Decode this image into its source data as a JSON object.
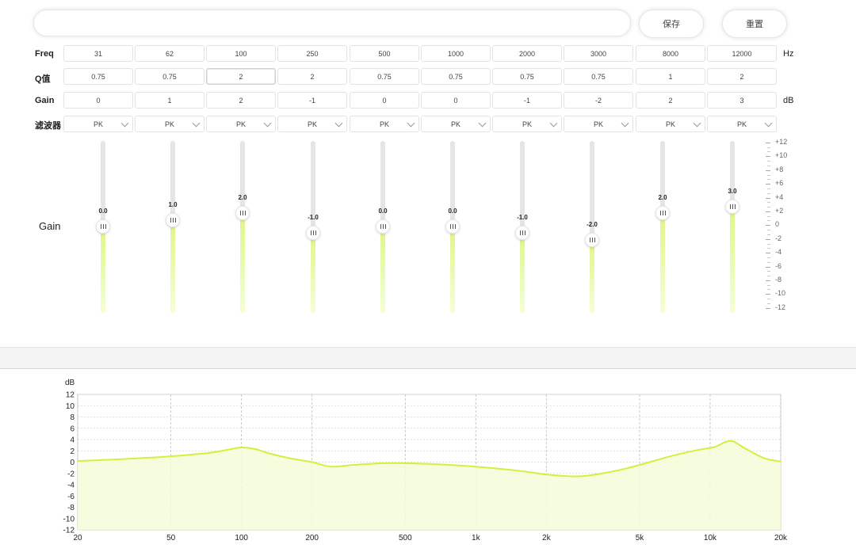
{
  "toolbar": {
    "name_value": "",
    "save_label": "保存",
    "reset_label": "重置"
  },
  "rows": {
    "freq_label": "Freq",
    "q_label": "Q值",
    "gain_label": "Gain",
    "filter_label": "滤波器",
    "freq_unit": "Hz",
    "gain_unit": "dB"
  },
  "bands": [
    {
      "freq": "31",
      "q": "0.75",
      "gain": "0",
      "filter": "PK",
      "slider_value": 0.0,
      "slider_label": "0.0"
    },
    {
      "freq": "62",
      "q": "0.75",
      "gain": "1",
      "filter": "PK",
      "slider_value": 1.0,
      "slider_label": "1.0"
    },
    {
      "freq": "100",
      "q": "2",
      "gain": "2",
      "filter": "PK",
      "slider_value": 2.0,
      "slider_label": "2.0"
    },
    {
      "freq": "250",
      "q": "2",
      "gain": "-1",
      "filter": "PK",
      "slider_value": -1.0,
      "slider_label": "-1.0"
    },
    {
      "freq": "500",
      "q": "0.75",
      "gain": "0",
      "filter": "PK",
      "slider_value": 0.0,
      "slider_label": "0.0"
    },
    {
      "freq": "1000",
      "q": "0.75",
      "gain": "0",
      "filter": "PK",
      "slider_value": 0.0,
      "slider_label": "0.0"
    },
    {
      "freq": "2000",
      "q": "0.75",
      "gain": "-1",
      "filter": "PK",
      "slider_value": -1.0,
      "slider_label": "-1.0"
    },
    {
      "freq": "3000",
      "q": "0.75",
      "gain": "-2",
      "filter": "PK",
      "slider_value": -2.0,
      "slider_label": "-2.0"
    },
    {
      "freq": "8000",
      "q": "1",
      "gain": "2",
      "filter": "PK",
      "slider_value": 2.0,
      "slider_label": "2.0"
    },
    {
      "freq": "12000",
      "q": "2",
      "gain": "3",
      "filter": "PK",
      "slider_value": 3.0,
      "slider_label": "3.0"
    }
  ],
  "slider_section": {
    "label": "Gain",
    "scale_labels": [
      "+12",
      "+10",
      "+8",
      "+6",
      "+4",
      "+2",
      "0",
      "-2",
      "-4",
      "-6",
      "-8",
      "-10",
      "-12"
    ]
  },
  "colors": {
    "accent_curve": "#d4f03c",
    "accent_fill": "#f4fbd8",
    "grid": "#d6d6d6"
  },
  "chart_data": {
    "type": "area",
    "ylabel": "dB",
    "ylim": [
      -12,
      12
    ],
    "xlim": [
      20,
      20000
    ],
    "x_scale": "log",
    "yticks": [
      12,
      10,
      8,
      6,
      4,
      2,
      0,
      -2,
      -4,
      -6,
      -8,
      -10,
      -12
    ],
    "xticks": [
      {
        "value": 20,
        "label": "20"
      },
      {
        "value": 50,
        "label": "50"
      },
      {
        "value": 100,
        "label": "100"
      },
      {
        "value": 200,
        "label": "200"
      },
      {
        "value": 500,
        "label": "500"
      },
      {
        "value": 1000,
        "label": "1k"
      },
      {
        "value": 2000,
        "label": "2k"
      },
      {
        "value": 5000,
        "label": "5k"
      },
      {
        "value": 10000,
        "label": "10k"
      },
      {
        "value": 20000,
        "label": "20k"
      }
    ],
    "grid": true,
    "x": [
      20,
      30,
      45,
      60,
      75,
      90,
      100,
      115,
      130,
      160,
      200,
      240,
      300,
      400,
      500,
      700,
      1000,
      1500,
      2000,
      2500,
      3000,
      4000,
      5000,
      7000,
      9000,
      10500,
      11500,
      12500,
      14000,
      17000,
      20000
    ],
    "y": [
      0.2,
      0.5,
      0.9,
      1.3,
      1.7,
      2.3,
      2.6,
      2.3,
      1.6,
      0.7,
      0.0,
      -0.8,
      -0.5,
      -0.2,
      -0.2,
      -0.4,
      -0.8,
      -1.5,
      -2.2,
      -2.5,
      -2.4,
      -1.5,
      -0.5,
      1.2,
      2.2,
      2.7,
      3.5,
      3.7,
      2.5,
      0.7,
      0.1
    ]
  }
}
